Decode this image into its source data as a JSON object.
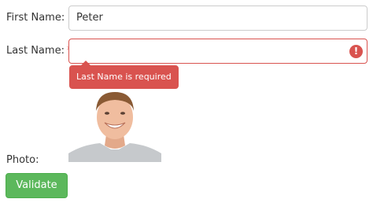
{
  "form": {
    "first_name": {
      "label": "First Name:",
      "value": "Peter"
    },
    "last_name": {
      "label": "Last Name:",
      "required_marker": "*",
      "value": "",
      "error_icon": "exclamation-icon",
      "error_glyph": "!",
      "error_message": "Last Name is required"
    },
    "photo": {
      "label": "Photo:",
      "image": "smiling-man-portrait"
    },
    "validate_button": "Validate"
  },
  "colors": {
    "error": "#d9534f",
    "success": "#5cb85c",
    "border": "#cccccc",
    "text": "#333333"
  }
}
